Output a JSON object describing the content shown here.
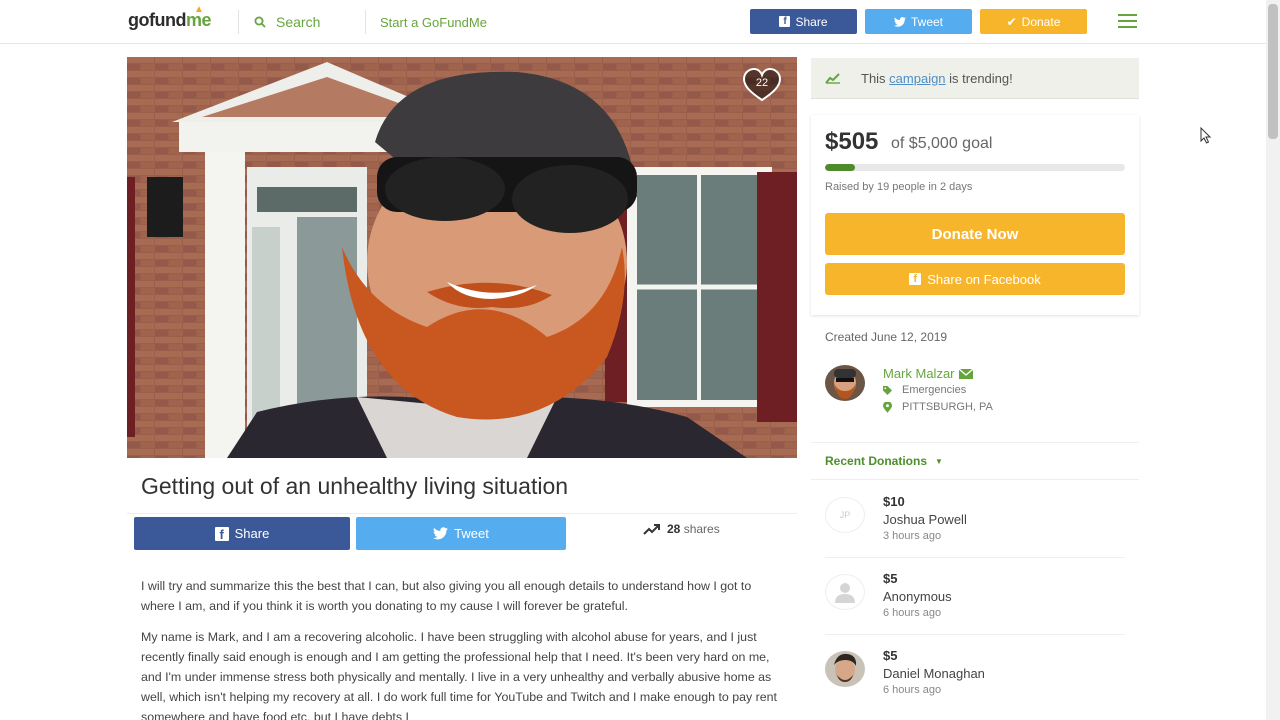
{
  "header": {
    "logo_go": "gofund",
    "logo_me": "me",
    "search_label": "Search",
    "start_label": "Start a GoFundMe",
    "share_label": "Share",
    "tweet_label": "Tweet",
    "donate_label": "Donate"
  },
  "campaign": {
    "hearts": "22",
    "title": "Getting out of an unhealthy living situation",
    "share_label": "Share",
    "tweet_label": "Tweet",
    "shares_count": "28",
    "shares_label": "shares",
    "story": [
      "I will try and summarize this the best that I can, but also giving you all enough details to understand how I got to where I am, and if you think it is worth you donating to my cause I will forever be grateful.",
      "My name is Mark, and I am a recovering alcoholic. I have been struggling with alcohol abuse for years, and I just recently finally said enough is enough and I am getting the professional help that I need. It's been very hard on me, and I'm under immense stress both physically and mentally. I live in a very unhealthy and verbally abusive home as well, which isn't helping my recovery at all. I do work full time for YouTube and Twitch and I make enough to pay rent somewhere and have food etc, but I have debts I"
    ]
  },
  "sidebar": {
    "trend_prefix": "This ",
    "trend_link": "campaign",
    "trend_suffix": " is trending!",
    "raised": "$505",
    "goal": "of $5,000 goal",
    "progress_fraction": 0.101,
    "raised_by": "Raised by 19 people in 2 days",
    "donate_now": "Donate Now",
    "share_facebook": "Share on Facebook",
    "created": "Created June 12, 2019",
    "organizer": "Mark Malzar",
    "category": "Emergencies",
    "location": "PITTSBURGH, PA",
    "recent_label": "Recent Donations"
  },
  "donations": [
    {
      "amount": "$10",
      "name": "Joshua Powell",
      "time": "3 hours ago",
      "initials": "JP"
    },
    {
      "amount": "$5",
      "name": "Anonymous",
      "time": "6 hours ago",
      "initials": ""
    },
    {
      "amount": "$5",
      "name": "Daniel Monaghan",
      "time": "6 hours ago",
      "initials": ""
    }
  ],
  "colors": {
    "brand_green": "#66a53d",
    "facebook": "#3b5998",
    "twitter": "#55acee",
    "donate": "#f7b52b"
  }
}
